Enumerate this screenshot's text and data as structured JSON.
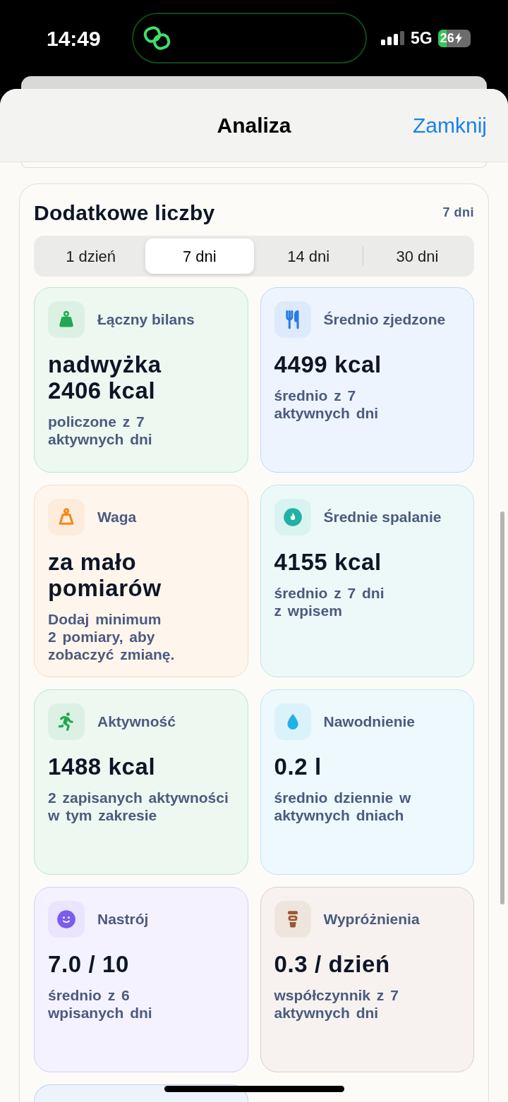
{
  "status_bar": {
    "time": "14:49",
    "network": "5G",
    "battery": "26"
  },
  "header": {
    "title": "Analiza",
    "close_button": "Zamknij"
  },
  "section": {
    "title": "Dodatkowe liczby",
    "range": "7 dni",
    "segments": [
      {
        "label": "1 dzień",
        "selected": false
      },
      {
        "label": "7 dni",
        "selected": true
      },
      {
        "label": "14 dni",
        "selected": false
      },
      {
        "label": "30 dni",
        "selected": false
      }
    ],
    "cards": [
      {
        "kind": "balance",
        "color": "#22a855",
        "label": "Łączny bilans",
        "value": "nadwyżka 2406 kcal",
        "note": "policzone z 7 aktywnych dni"
      },
      {
        "kind": "intake",
        "color": "#2a7be4",
        "label": "Średnio zjedzone",
        "value": "4499 kcal",
        "note": "średnio z 7 aktywnych dni"
      },
      {
        "kind": "weight",
        "color": "#f28a1d",
        "label": "Waga",
        "value": "za mało pomiarów",
        "note": "Dodaj minimum 2 pomiary, aby zobaczyć zmianę."
      },
      {
        "kind": "burn",
        "color": "#1fb3a4",
        "label": "Średnie spalanie",
        "value": "4155 kcal",
        "note": "średnio z 7 dni z wpisem"
      },
      {
        "kind": "activity",
        "color": "#22a855",
        "label": "Aktywność",
        "value": "1488 kcal",
        "note": "2 zapisanych aktywności w tym zakresie"
      },
      {
        "kind": "hydration",
        "color": "#22b0e8",
        "label": "Nawodnienie",
        "value": "0.2 l",
        "note": "średnio dziennie w aktywnych dniach"
      },
      {
        "kind": "mood",
        "color": "#7a5cf0",
        "label": "Nastrój",
        "value": "7.0 / 10",
        "note": "średnio z 6 wpisanych dni"
      },
      {
        "kind": "bowel",
        "color": "#9a5a35",
        "label": "Wypróżnienia",
        "value": "0.3 / dzień",
        "note": "współczynnik z 7 aktywnych dni"
      }
    ]
  }
}
